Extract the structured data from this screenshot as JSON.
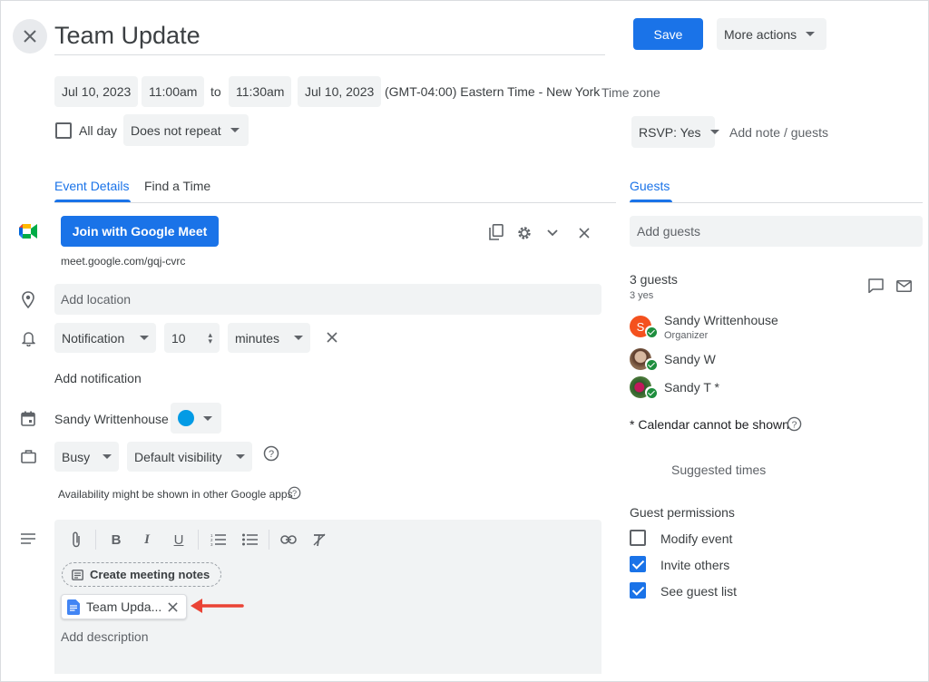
{
  "header": {
    "title": "Team Update",
    "save_label": "Save",
    "more_actions_label": "More actions"
  },
  "when": {
    "start_date": "Jul 10, 2023",
    "start_time": "11:00am",
    "to_label": "to",
    "end_time": "11:30am",
    "end_date": "Jul 10, 2023",
    "timezone_value": "(GMT-04:00) Eastern Time - New York",
    "timezone_link": "Time zone",
    "all_day_label": "All day",
    "all_day_checked": false,
    "repeat": "Does not repeat"
  },
  "rsvp": {
    "value": "RSVP: Yes",
    "add_note": "Add note / guests"
  },
  "tabs": {
    "event_details": "Event Details",
    "find_time": "Find a Time",
    "guests": "Guests"
  },
  "meet": {
    "join_label": "Join with Google Meet",
    "link": "meet.google.com/gqj-cvrc"
  },
  "location": {
    "placeholder": "Add location"
  },
  "notification": {
    "type": "Notification",
    "amount": "10",
    "unit": "minutes",
    "add_label": "Add notification"
  },
  "calendar": {
    "owner": "Sandy Writtenhouse",
    "color": "#039be5"
  },
  "availability": {
    "status": "Busy",
    "visibility": "Default visibility",
    "note": "Availability might be shown in other Google apps"
  },
  "description": {
    "create_notes": "Create meeting notes",
    "attachment": "Team Upda...",
    "placeholder": "Add description"
  },
  "guests": {
    "add_placeholder": "Add guests",
    "count": "3 guests",
    "yes_count": "3 yes",
    "list": [
      {
        "name": "Sandy Writtenhouse",
        "role": "Organizer",
        "initial": "S"
      },
      {
        "name": "Sandy W",
        "role": ""
      },
      {
        "name": "Sandy T *",
        "role": ""
      }
    ],
    "calendar_note": "* Calendar cannot be shown",
    "suggested_times": "Suggested times"
  },
  "permissions": {
    "title": "Guest permissions",
    "modify": "Modify event",
    "invite": "Invite others",
    "see_list": "See guest list"
  },
  "colors": {
    "accent": "#1a73e8",
    "annotation_arrow": "#ea4335",
    "organizer_avatar": "#f4511e"
  }
}
